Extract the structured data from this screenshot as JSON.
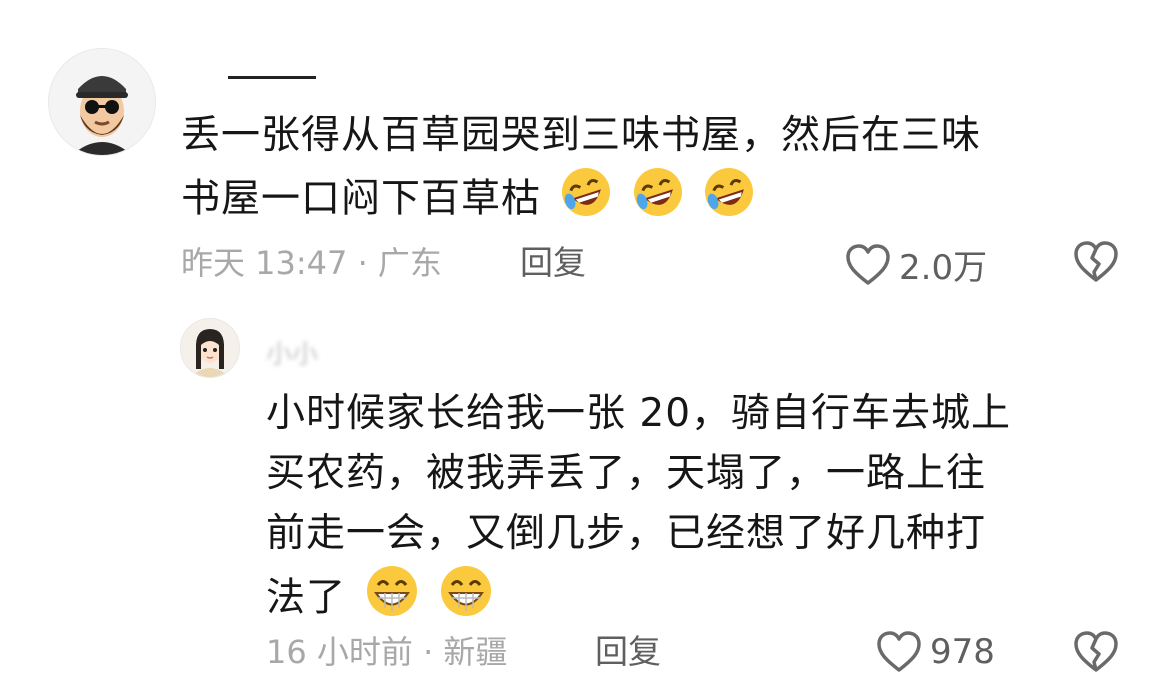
{
  "comments": [
    {
      "username": "——",
      "text_lines": [
        "丢一张得从百草园哭到三味书屋，然后在三味",
        "书屋一口闷下百草枯"
      ],
      "emojis": [
        "rofl",
        "rofl",
        "rofl"
      ],
      "time_location": "昨天 13:47 · 广东",
      "reply_label": "回复",
      "like_count": "2.0万"
    },
    {
      "username": "小小",
      "text_lines": [
        "小时候家长给我一张 20，骑自行车去城上",
        "买农药，被我弄丢了，天塌了，一路上往",
        "前走一会，又倒几步，已经想了好几种打",
        "法了"
      ],
      "emojis": [
        "grin",
        "grin"
      ],
      "time_location": "16 小时前 · 新疆",
      "reply_label": "回复",
      "like_count": "978"
    }
  ],
  "icons": {
    "like": "heart-outline-icon",
    "dislike": "broken-heart-icon"
  }
}
